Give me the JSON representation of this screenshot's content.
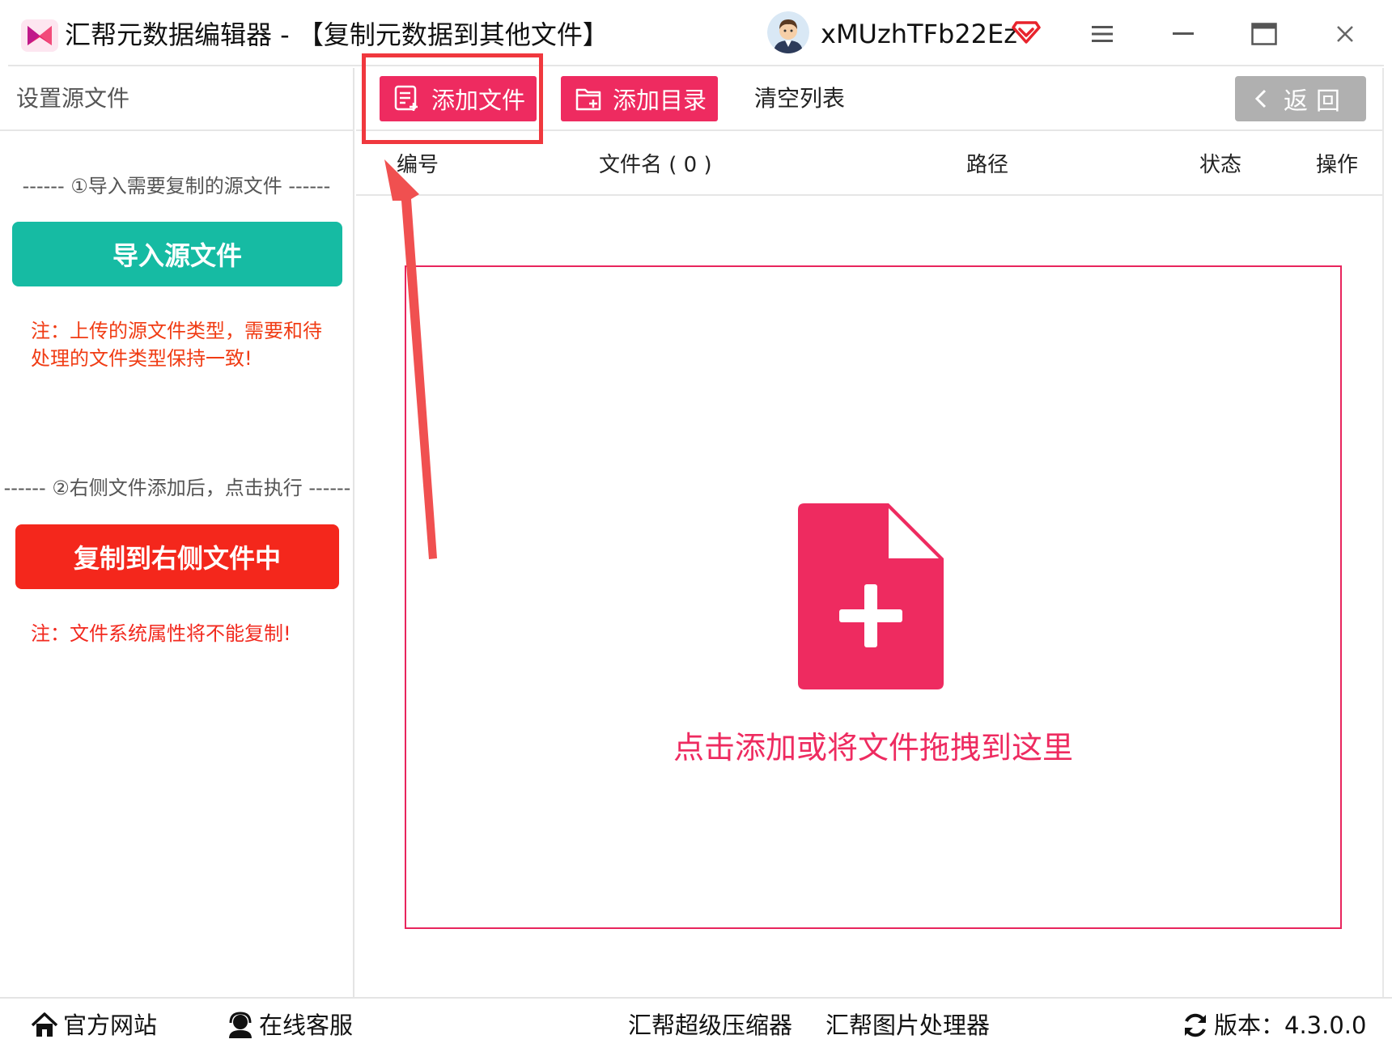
{
  "window": {
    "title": "汇帮元数据编辑器 - 【复制元数据到其他文件】",
    "username": "xMUzhTFb22Ez",
    "icons": [
      "app-logo",
      "avatar",
      "vip-icon",
      "menu-icon",
      "minimize-icon",
      "maximize-icon",
      "close-icon"
    ]
  },
  "left_panel": {
    "header": "设置源文件",
    "step1_label": "------ ①导入需要复制的源文件 ------",
    "import_button": "导入源文件",
    "note1": "注：上传的源文件类型，需要和待处理的文件类型保持一致!",
    "step2_label": "------ ②右侧文件添加后，点击执行 ------",
    "copy_button": "复制到右侧文件中",
    "note2": "注：文件系统属性将不能复制!"
  },
  "toolbar": {
    "add_file": "添加文件",
    "add_directory": "添加目录",
    "clear_list": "清空列表",
    "back": "返回"
  },
  "table": {
    "columns": [
      "编号",
      "文件名 ( 0 )",
      "路径",
      "状态",
      "操作"
    ]
  },
  "drop_zone": {
    "text": "点击添加或将文件拖拽到这里"
  },
  "bottom_bar": {
    "website": "官方网站",
    "support": "在线客服",
    "compressor": "汇帮超级压缩器",
    "image_processor": "汇帮图片处理器",
    "version": "版本：4.3.0.0"
  },
  "colors": {
    "accent_pink": "#ee2b60",
    "teal": "#16bba3",
    "red": "#f4271c",
    "note_red": "#f03c14",
    "back_gray": "#b0b0b0"
  }
}
